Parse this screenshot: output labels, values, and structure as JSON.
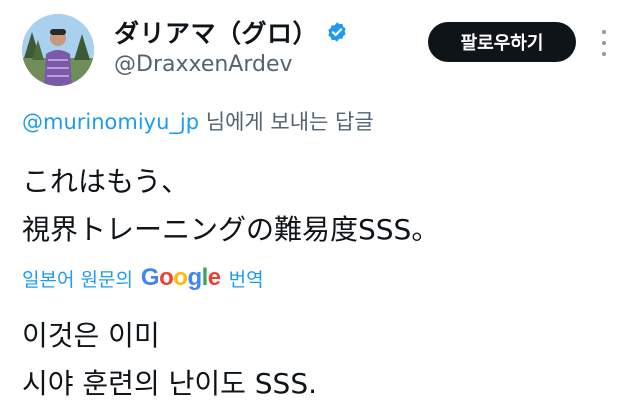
{
  "author": {
    "display_name": "ダリアマ（グロ）",
    "handle": "@DraxxenArdev",
    "verified_icon": "verified-badge-icon"
  },
  "follow_button": {
    "label": "팔로우하기"
  },
  "more_button": {
    "icon": "more-vertical-icon"
  },
  "reply_to": {
    "mention": "@murinomiyu_jp",
    "suffix": " 님에게 보내는 답글"
  },
  "tweet": {
    "line1": "これはもう、",
    "line2": "視界トレーニングの難易度SSS。"
  },
  "translation": {
    "prefix": "일본어 원문의",
    "suffix": "번역",
    "google_letters": [
      "G",
      "o",
      "o",
      "g",
      "l",
      "e"
    ],
    "line1": "이것은 이미",
    "line2": "시야 훈련의 난이도 SSS."
  },
  "colors": {
    "link_blue": "#1d9bf0",
    "secondary_text": "#536471",
    "follow_bg": "#0f1419"
  }
}
